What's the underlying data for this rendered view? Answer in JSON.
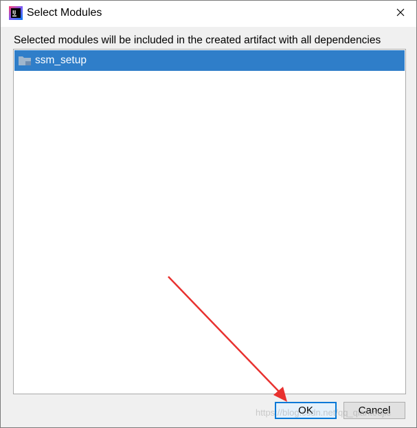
{
  "dialog": {
    "title": "Select Modules",
    "description": "Selected modules will be included in the created artifact with all dependencies"
  },
  "modules": [
    {
      "name": "ssm_setup",
      "selected": true
    }
  ],
  "buttons": {
    "ok": "OK",
    "cancel": "Cancel"
  },
  "watermark": "https://blog.csdn.net/qq_qiantoujie",
  "icons": {
    "app": "intellij-idea-icon",
    "close": "close-icon",
    "module": "module-folder-icon"
  },
  "colors": {
    "selection": "#2f7ec9",
    "focus_border": "#0078d7",
    "annotation_arrow": "#e8312f"
  }
}
